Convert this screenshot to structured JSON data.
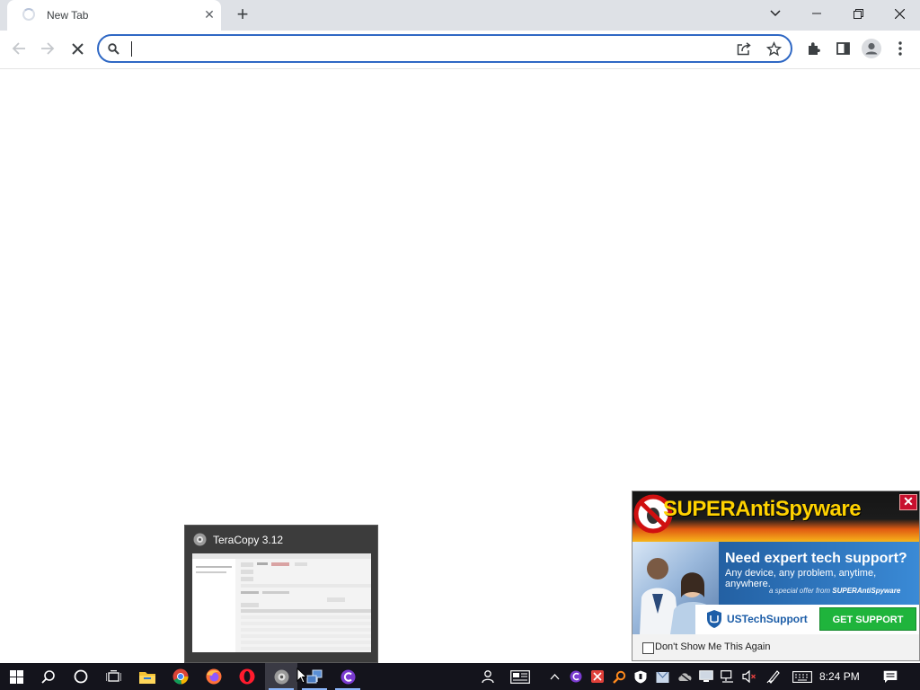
{
  "browser": {
    "tab_title": "New Tab",
    "tab_close_glyph": "✕",
    "newtab_glyph": "+",
    "omnibox_value": "",
    "icons": [
      "back-arrow-icon",
      "forward-arrow-icon",
      "stop-icon",
      "search-icon",
      "share-icon",
      "star-icon",
      "extensions-icon",
      "side-panel-icon",
      "profile-icon",
      "kebab-menu-icon"
    ]
  },
  "window_controls": {
    "icons": [
      "tab-search-icon",
      "minimize-icon",
      "restore-icon",
      "close-icon"
    ]
  },
  "preview": {
    "title": "TeraCopy 3.12"
  },
  "ad": {
    "brand": "SUPERAntiSpyware",
    "close_glyph": "✕",
    "headline": "Need expert tech support?",
    "subline": "Any device, any problem, anytime, anywhere.",
    "offer_prefix": "a special offer from",
    "offer_brand": "SUPERAntiSpyware",
    "ustech": "USTechSupport",
    "cta": "GET SUPPORT",
    "checkbox_label": "Don't Show Me This Again"
  },
  "taskbar": {
    "clock": "8:24 PM",
    "apps": [
      "windows-start-icon",
      "search-icon",
      "cortana-icon",
      "task-view-icon",
      "file-explorer-icon",
      "chrome-icon",
      "firefox-icon",
      "opera-icon",
      "teracopy-icon",
      "network-app-icon",
      "ccleaner-icon"
    ],
    "tray": [
      "people-icon",
      "news-icon",
      "show-hidden-icons",
      "ccleaner-tray-icon",
      "tray-app-icon",
      "search-tray-icon",
      "security-shield-icon",
      "tray-box-icon",
      "tray-cloud-icon",
      "tray-monitor-icon",
      "network-icon",
      "volume-muted-icon",
      "pen-icon",
      "keyboard-icon",
      "notifications-icon"
    ]
  },
  "colors": {
    "tabstrip": "#dee1e6",
    "omnibox_border": "#2f68c4",
    "taskbar": "#14141c",
    "ad_cta": "#1fb43c",
    "ad_brand": "#ffd200"
  }
}
